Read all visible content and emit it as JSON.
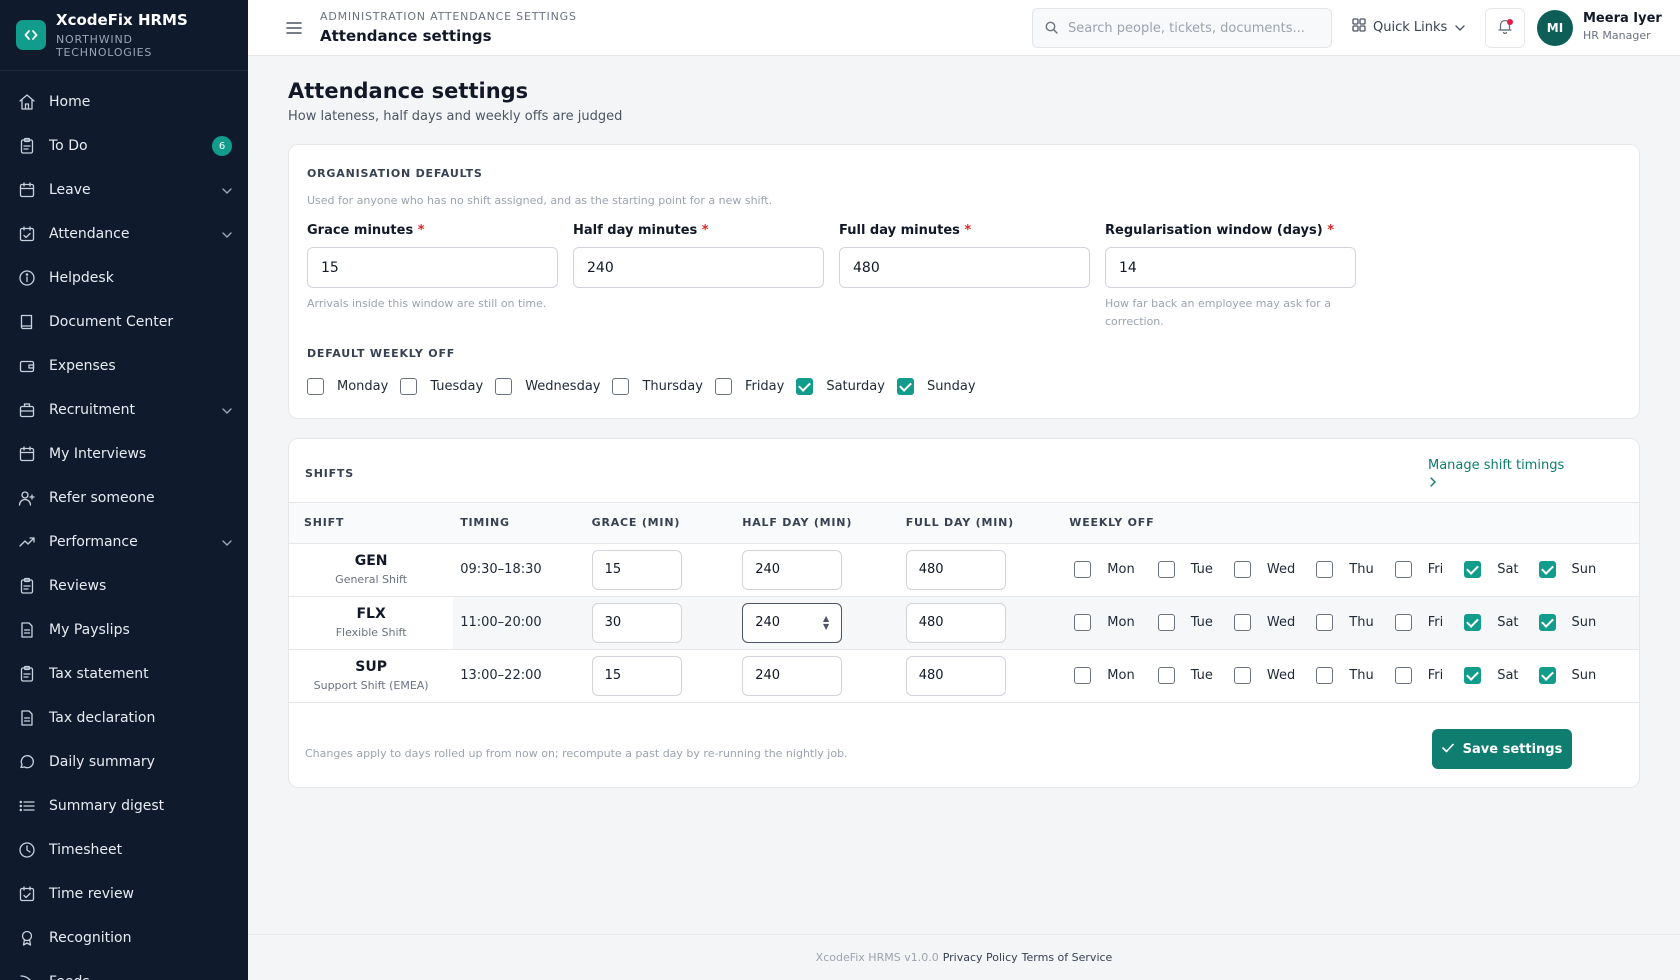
{
  "brand": {
    "name": "XcodeFix HRMS",
    "org": "NORTHWIND TECHNOLOGIES",
    "logo_icon": "code-brackets-icon"
  },
  "sidebar": {
    "items": [
      {
        "label": "Home",
        "icon": "home-icon"
      },
      {
        "label": "To Do",
        "icon": "clipboard-icon",
        "badge": "6"
      },
      {
        "label": "Leave",
        "icon": "calendar-icon",
        "chevron": true
      },
      {
        "label": "Attendance",
        "icon": "calendar-check-icon",
        "chevron": true
      },
      {
        "label": "Helpdesk",
        "icon": "info-icon"
      },
      {
        "label": "Document Center",
        "icon": "book-icon"
      },
      {
        "label": "Expenses",
        "icon": "wallet-icon"
      },
      {
        "label": "Recruitment",
        "icon": "briefcase-icon",
        "chevron": true
      },
      {
        "label": "My Interviews",
        "icon": "calendar-icon"
      },
      {
        "label": "Refer someone",
        "icon": "user-plus-icon"
      },
      {
        "label": "Performance",
        "icon": "trend-icon",
        "chevron": true
      },
      {
        "label": "Reviews",
        "icon": "clipboard-icon"
      },
      {
        "label": "My Payslips",
        "icon": "document-icon"
      },
      {
        "label": "Tax statement",
        "icon": "clipboard-icon"
      },
      {
        "label": "Tax declaration",
        "icon": "document-icon"
      },
      {
        "label": "Daily summary",
        "icon": "chat-icon"
      },
      {
        "label": "Summary digest",
        "icon": "list-icon"
      },
      {
        "label": "Timesheet",
        "icon": "clock-icon"
      },
      {
        "label": "Time review",
        "icon": "calendar-check-icon"
      },
      {
        "label": "Recognition",
        "icon": "award-icon"
      },
      {
        "label": "Feeds",
        "icon": "feed-icon"
      }
    ]
  },
  "topbar": {
    "breadcrumb": "ADMINISTRATION ATTENDANCE SETTINGS",
    "title": "Attendance settings",
    "search_placeholder": "Search people, tickets, documents...",
    "quick_links": "Quick Links",
    "user": {
      "initials": "MI",
      "name": "Meera Iyer",
      "role": "HR Manager"
    }
  },
  "page": {
    "title": "Attendance settings",
    "subtitle": "How lateness, half days and weekly offs are judged"
  },
  "defaults": {
    "section": "ORGANISATION DEFAULTS",
    "help": "Used for anyone who has no shift assigned, and as the starting point for a new shift.",
    "fields": [
      {
        "label": "Grace minutes",
        "value": "15",
        "help": "Arrivals inside this window are still on time."
      },
      {
        "label": "Half day minutes",
        "value": "240",
        "help": ""
      },
      {
        "label": "Full day minutes",
        "value": "480",
        "help": ""
      },
      {
        "label": "Regularisation window (days)",
        "value": "14",
        "help": "How far back an employee may ask for a correction."
      }
    ],
    "required_mark": "*",
    "weekly_off_title": "DEFAULT WEEKLY OFF",
    "weekly_off": [
      {
        "label": "Monday",
        "checked": false
      },
      {
        "label": "Tuesday",
        "checked": false
      },
      {
        "label": "Wednesday",
        "checked": false
      },
      {
        "label": "Thursday",
        "checked": false
      },
      {
        "label": "Friday",
        "checked": false
      },
      {
        "label": "Saturday",
        "checked": true
      },
      {
        "label": "Sunday",
        "checked": true
      }
    ]
  },
  "shifts": {
    "section": "SHIFTS",
    "manage_link": "Manage shift timings",
    "columns": [
      "SHIFT",
      "TIMING",
      "GRACE (MIN)",
      "HALF DAY (MIN)",
      "FULL DAY (MIN)",
      "WEEKLY OFF"
    ],
    "day_labels": [
      "Mon",
      "Tue",
      "Wed",
      "Thu",
      "Fri",
      "Sat",
      "Sun"
    ],
    "rows": [
      {
        "code": "GEN",
        "name": "General Shift",
        "timing": "09:30–18:30",
        "grace": "15",
        "half": "240",
        "full": "480",
        "off": [
          false,
          false,
          false,
          false,
          false,
          true,
          true
        ]
      },
      {
        "code": "FLX",
        "name": "Flexible Shift",
        "timing": "11:00–20:00",
        "grace": "30",
        "half": "240",
        "full": "480",
        "off": [
          false,
          false,
          false,
          false,
          false,
          true,
          true
        ]
      },
      {
        "code": "SUP",
        "name": "Support Shift (EMEA)",
        "timing": "13:00–22:00",
        "grace": "15",
        "half": "240",
        "full": "480",
        "off": [
          false,
          false,
          false,
          false,
          false,
          true,
          true
        ]
      }
    ],
    "footnote": "Changes apply to days rolled up from now on; recompute a past day by re-running the nightly job.",
    "save_label": "Save settings"
  },
  "footer": {
    "version": "XcodeFix HRMS v1.0.0",
    "privacy": "Privacy Policy",
    "terms": "Terms of Service"
  },
  "colors": {
    "accent": "#119c8c",
    "sidebar": "#0f1b2d",
    "button": "#0f7d70",
    "required": "#dc2626"
  }
}
